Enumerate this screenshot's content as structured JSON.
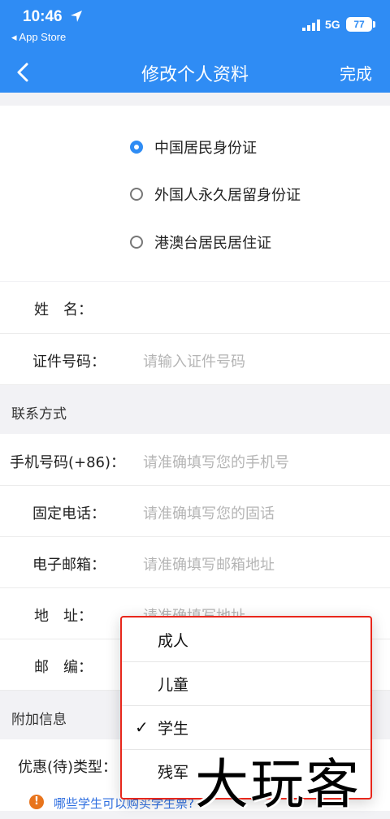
{
  "status_bar": {
    "time": "10:46",
    "back_to_app": "◂ App Store",
    "network": "5G",
    "battery": "77"
  },
  "nav": {
    "title": "修改个人资料",
    "done": "完成"
  },
  "id_types": [
    {
      "label": "中国居民身份证",
      "selected": true
    },
    {
      "label": "外国人永久居留身份证",
      "selected": false
    },
    {
      "label": "港澳台居民居住证",
      "selected": false
    }
  ],
  "fields": {
    "name_label": "姓　名：",
    "id_number_label": "证件号码：",
    "id_number_placeholder": "请输入证件号码"
  },
  "contact": {
    "section_title": "联系方式",
    "mobile_label": "手机号码(+86)：",
    "mobile_placeholder": "请准确填写您的手机号",
    "landline_label": "固定电话：",
    "landline_placeholder": "请准确填写您的固话",
    "email_label": "电子邮箱：",
    "email_placeholder": "请准确填写邮箱地址",
    "address_label": "地　址：",
    "address_placeholder": "请准确填写地址",
    "postcode_label": "邮　编："
  },
  "extra": {
    "section_title": "附加信息",
    "discount_label": "优惠(待)类型："
  },
  "passenger_type_menu": {
    "options": [
      "成人",
      "儿童",
      "学生",
      "残军"
    ],
    "selected": "学生",
    "check_mark": "✓"
  },
  "notice": {
    "icon": "!",
    "text": "哪些学生可以购买学生票?"
  },
  "watermark": "大玩客"
}
